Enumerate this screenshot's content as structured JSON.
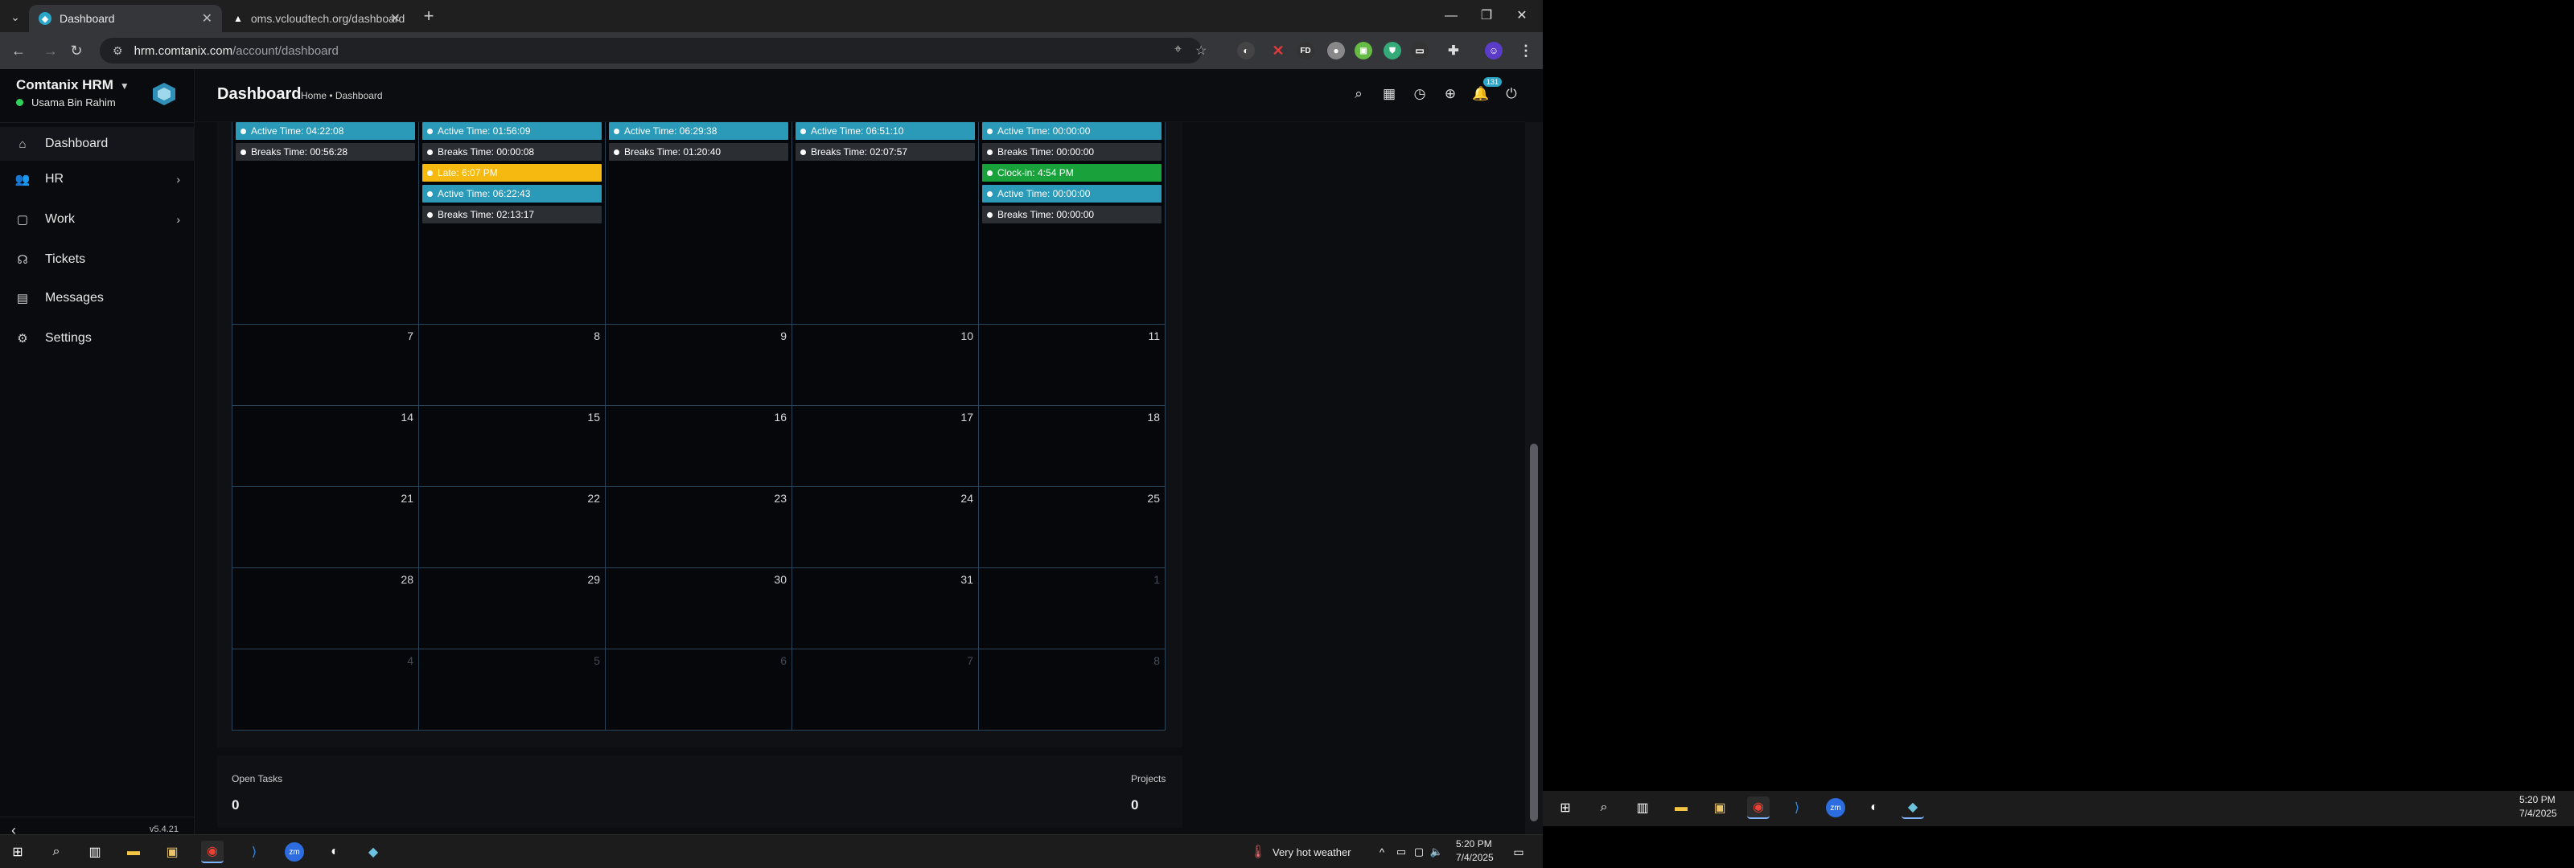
{
  "browser": {
    "tabs": [
      {
        "title": "Dashboard",
        "favicon": "comtanix-logo-icon"
      },
      {
        "title": "oms.vcloudtech.org/dashboard",
        "favicon": "vcloud-icon"
      }
    ],
    "url_host": "hrm.comtanix.com",
    "url_path": "/account/dashboard"
  },
  "app": {
    "brand": "Comtanix HRM",
    "user": "Usama Bin Rahim",
    "version": "v5.4.21",
    "nav": [
      {
        "label": "Dashboard",
        "icon": "home-icon",
        "active": true
      },
      {
        "label": "HR",
        "icon": "users-icon",
        "has_sub": true
      },
      {
        "label": "Work",
        "icon": "briefcase-icon",
        "has_sub": true
      },
      {
        "label": "Tickets",
        "icon": "headset-icon"
      },
      {
        "label": "Messages",
        "icon": "message-icon"
      },
      {
        "label": "Settings",
        "icon": "gear-icon"
      }
    ],
    "header": {
      "title": "Dashboard",
      "breadcrumb": "Home • Dashboard",
      "notification_count": "131"
    }
  },
  "calendar": {
    "first_row_events": [
      [
        {
          "text": "Active Time: 04:22:08",
          "color": "teal"
        },
        {
          "text": "Breaks Time: 00:56:28",
          "color": "gray"
        }
      ],
      [
        {
          "text": "Active Time: 01:56:09",
          "color": "teal"
        },
        {
          "text": "Breaks Time: 00:00:08",
          "color": "gray"
        },
        {
          "text": "Late: 6:07 PM",
          "color": "yellow"
        },
        {
          "text": "Active Time: 06:22:43",
          "color": "teal"
        },
        {
          "text": "Breaks Time: 02:13:17",
          "color": "gray"
        }
      ],
      [
        {
          "text": "Active Time: 06:29:38",
          "color": "teal"
        },
        {
          "text": "Breaks Time: 01:20:40",
          "color": "gray"
        }
      ],
      [
        {
          "text": "Active Time: 06:51:10",
          "color": "teal"
        },
        {
          "text": "Breaks Time: 02:07:57",
          "color": "gray"
        }
      ],
      [
        {
          "text": "Active Time: 00:00:00",
          "color": "teal"
        },
        {
          "text": "Breaks Time: 00:00:00",
          "color": "gray"
        },
        {
          "text": "Clock-in: 4:54 PM",
          "color": "green"
        },
        {
          "text": "Active Time: 00:00:00",
          "color": "teal"
        },
        {
          "text": "Breaks Time: 00:00:00",
          "color": "gray"
        }
      ]
    ],
    "weeks": [
      [
        {
          "d": "7"
        },
        {
          "d": "8"
        },
        {
          "d": "9"
        },
        {
          "d": "10"
        },
        {
          "d": "11"
        }
      ],
      [
        {
          "d": "14"
        },
        {
          "d": "15"
        },
        {
          "d": "16"
        },
        {
          "d": "17"
        },
        {
          "d": "18"
        }
      ],
      [
        {
          "d": "21"
        },
        {
          "d": "22"
        },
        {
          "d": "23"
        },
        {
          "d": "24"
        },
        {
          "d": "25"
        }
      ],
      [
        {
          "d": "28"
        },
        {
          "d": "29"
        },
        {
          "d": "30"
        },
        {
          "d": "31"
        },
        {
          "d": "1",
          "muted": true
        }
      ],
      [
        {
          "d": "4",
          "muted": true
        },
        {
          "d": "5",
          "muted": true
        },
        {
          "d": "6",
          "muted": true
        },
        {
          "d": "7",
          "muted": true
        },
        {
          "d": "8",
          "muted": true
        }
      ]
    ]
  },
  "stats": {
    "open_tasks_label": "Open Tasks",
    "open_tasks_value": "0",
    "projects_label": "Projects",
    "projects_value": "0"
  },
  "taskbar": {
    "weather": "Very hot weather",
    "time": "5:20 PM",
    "date": "7/4/2025"
  },
  "taskbar2": {
    "time": "5:20 PM",
    "date": "7/4/2025"
  },
  "colors": {
    "teal": "#2a9ab8",
    "gray": "#2b2e33",
    "yellow": "#f6b90f",
    "green": "#19a23b",
    "grid": "#2a4459"
  }
}
